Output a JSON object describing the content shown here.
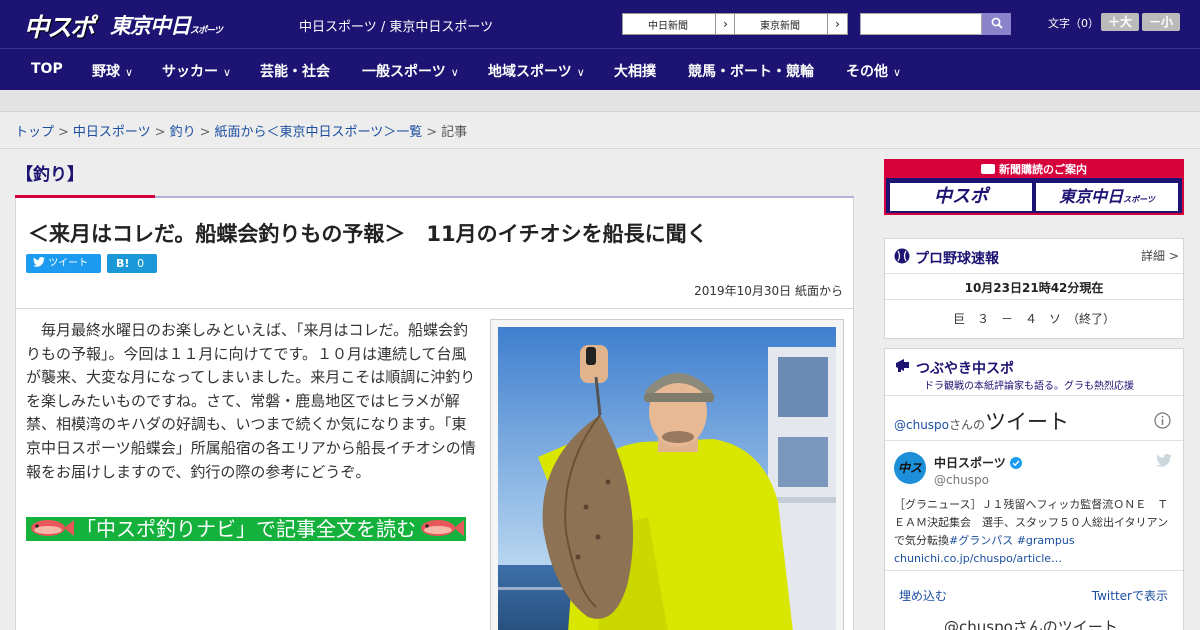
{
  "header": {
    "logo_chuspo": "中スポ",
    "logo_tokyo": "東京中日",
    "logo_tokyo_sub": "スポーツ",
    "site_title": "中日スポーツ / 東京中日スポーツ",
    "link_chunichi": "中日新聞",
    "link_tokyo": "東京新聞",
    "font_size_label": "文字（0）",
    "font_plus": "＋大",
    "font_minus": "－小"
  },
  "nav": [
    {
      "label": "TOP"
    },
    {
      "label": "野球"
    },
    {
      "label": "サッカー"
    },
    {
      "label": "芸能・社会"
    },
    {
      "label": "一般スポーツ"
    },
    {
      "label": "地域スポーツ"
    },
    {
      "label": "大相撲"
    },
    {
      "label": "競馬・ボート・競輪"
    },
    {
      "label": "その他"
    }
  ],
  "breadcrumb": {
    "items": [
      "トップ",
      "中日スポーツ",
      "釣り",
      "紙面から＜東京中日スポーツ＞一覧"
    ],
    "current": "記事",
    "separator": ">"
  },
  "article": {
    "section": "【釣り】",
    "title": "＜来月はコレだ。船蝶会釣りもの予報＞　11月のイチオシを船長に聞く",
    "tweet_label": "ツイート",
    "hatena_label": "B!",
    "hatena_count": "0",
    "date": "2019年10月30日 紙面から",
    "body": "毎月最終水曜日のお楽しみといえば、「来月はコレだ。船蝶会釣りもの予報」。今回は１１月に向けてです。１０月は連続して台風が襲来、大変な月になってしまいました。来月こそは順調に沖釣りを楽しみたいものですね。さて、常磐・鹿島地区ではヒラメが解禁、相模湾のキハダの好調も、いつまで続くか気になります。「東京中日スポーツ船蝶会」所属船宿の各エリアから船長イチオシの情報をお届けしますので、釣行の際の参考にどうぞ。",
    "navi_link": "「中スポ釣りナビ」で記事全文を読む"
  },
  "sidebar": {
    "ad": {
      "heading": "新聞購読のご案内",
      "logo1": "中スポ",
      "logo2": "東京中日",
      "logo2_sub": "スポーツ"
    },
    "baseball": {
      "title": "プロ野球速報",
      "more": "詳細 >",
      "updated": "10月23日21時42分現在",
      "score": "巨　３　－　４　ソ　（終了）"
    },
    "tsubuyaki": {
      "title": "つぶやき中スポ",
      "subtitle": "ドラ観戦の本紙評論家も語る。グラも熱烈応援",
      "timeline_handle": "@chuspo",
      "timeline_suffix": "さんの",
      "timeline_label": "ツイート",
      "tweet_author": "中日スポーツ",
      "tweet_handle": "@chuspo",
      "tweet_text": "［グラニュース］Ｊ１残留へフィッカ監督流ＯＮＥ　ＴＥＡＭ決起集会　選手、スタッフ５０人総出イタリアンで気分転換",
      "tweet_tags": "#グランパス #grampus",
      "tweet_url": "chunichi.co.jp/chuspo/article…",
      "embed": "埋め込む",
      "view_on_twitter": "Twitterで表示",
      "footer": "@chuspoさんのツイート"
    }
  },
  "colors": {
    "header_bg": "#1c1372",
    "accent_red": "#d6003a",
    "link": "#1b4fa0",
    "navi_green": "#14b23d"
  }
}
